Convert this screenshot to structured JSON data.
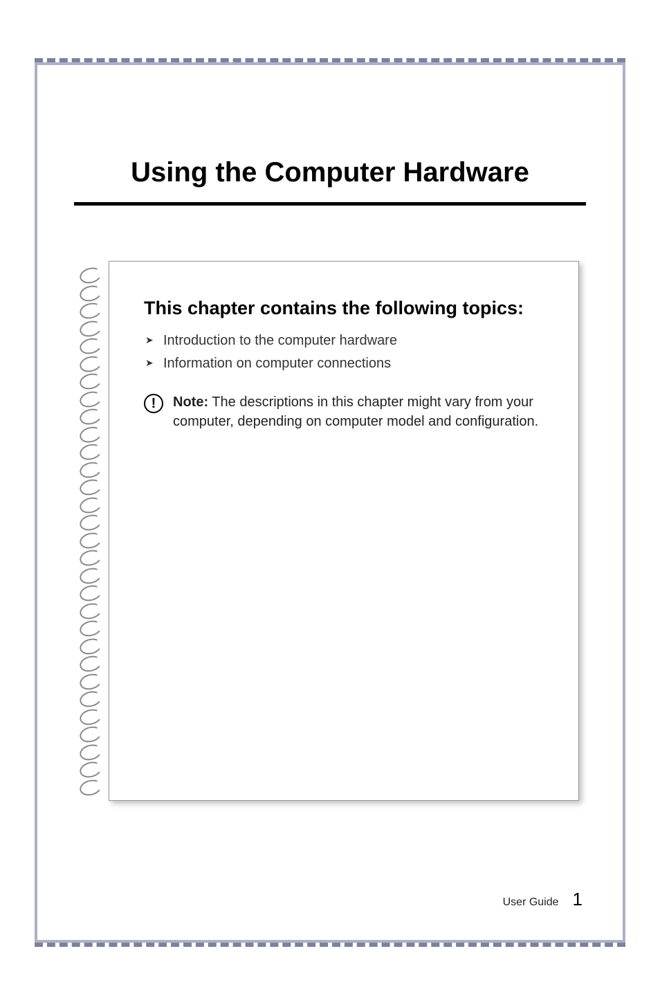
{
  "chapter": {
    "title": "Using the Computer Hardware"
  },
  "section": {
    "heading": "This chapter contains the following topics:",
    "topics": [
      "Introduction to the computer hardware",
      "Information on computer connections"
    ],
    "note_label": "Note:",
    "note_text": " The descriptions in this chapter might vary from your computer, depending on computer model and configuration."
  },
  "footer": {
    "label": "User Guide",
    "page_number": "1"
  }
}
